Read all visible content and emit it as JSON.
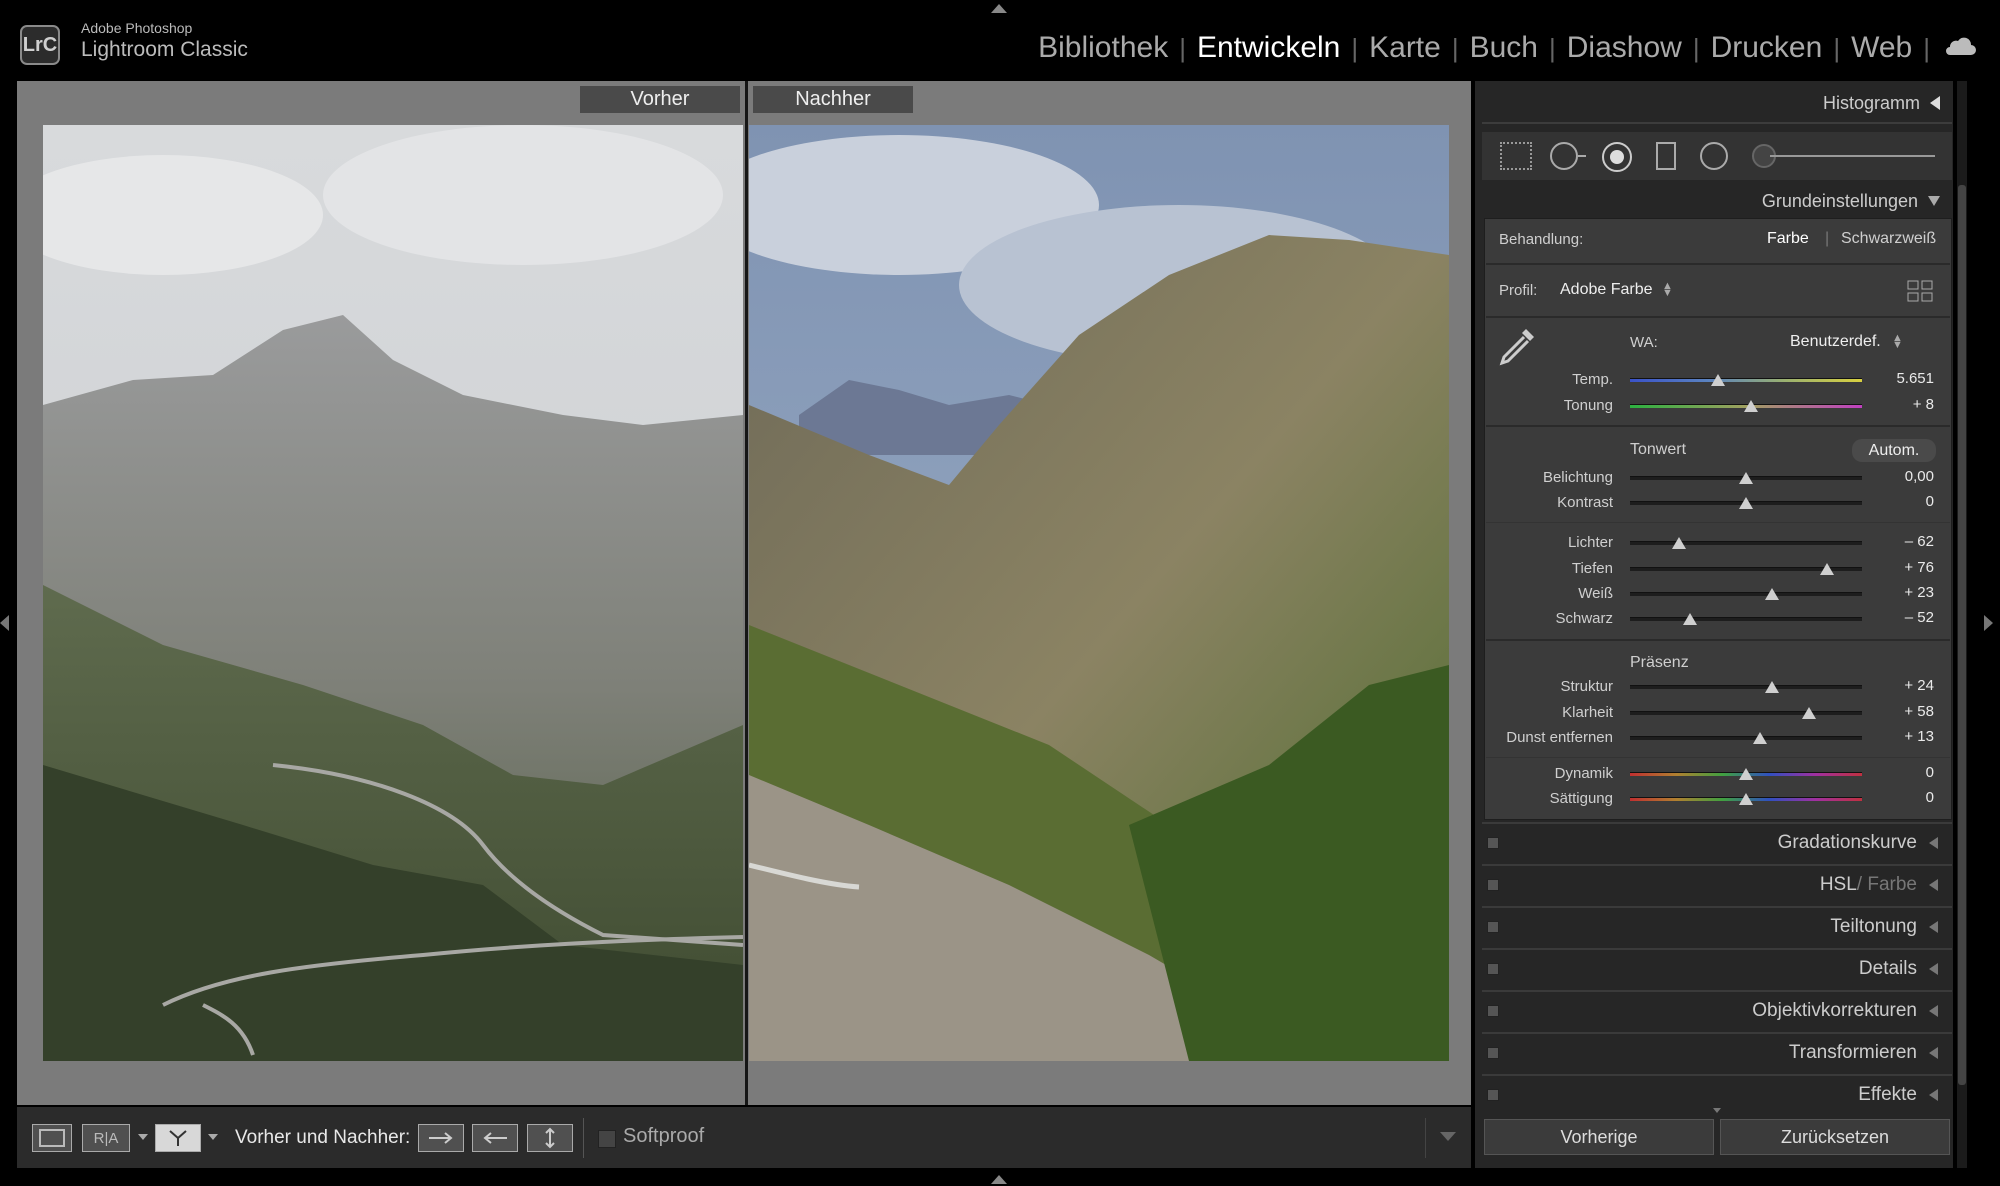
{
  "app": {
    "badge": "LrC",
    "line1": "Adobe Photoshop",
    "line2": "Lightroom Classic"
  },
  "modules": [
    "Bibliothek",
    "Entwickeln",
    "Karte",
    "Buch",
    "Diashow",
    "Drucken",
    "Web"
  ],
  "active_module": "Entwickeln",
  "viewer": {
    "before_label": "Vorher",
    "after_label": "Nachher"
  },
  "toolbar": {
    "ab_text": "R|A",
    "mode_label": "Vorher und Nachher:",
    "softproof_label": "Softproof"
  },
  "panel": {
    "histogram_title": "Histogramm",
    "basic_title": "Grundeinstellungen",
    "treatment": {
      "label": "Behandlung:",
      "color": "Farbe",
      "bw": "Schwarzweiß"
    },
    "profile": {
      "label": "Profil:",
      "value": "Adobe Farbe"
    },
    "wb": {
      "label": "WA:",
      "value": "Benutzerdef."
    },
    "tone_title": "Tonwert",
    "auto_label": "Autom.",
    "presence_title": "Präsenz",
    "sliders": [
      {
        "name": "temp",
        "label": "Temp.",
        "value": "5.651",
        "level": 0.38,
        "group": "wb"
      },
      {
        "name": "tonung",
        "label": "Tonung",
        "value": "+ 8",
        "level": 0.52,
        "group": "wb"
      },
      {
        "name": "belichtung",
        "label": "Belichtung",
        "value": "0,00",
        "level": 0.5,
        "group": "tone1"
      },
      {
        "name": "kontrast",
        "label": "Kontrast",
        "value": "0",
        "level": 0.5,
        "group": "tone1"
      },
      {
        "name": "lichter",
        "label": "Lichter",
        "value": "– 62",
        "level": 0.21,
        "group": "tone2"
      },
      {
        "name": "tiefen",
        "label": "Tiefen",
        "value": "+ 76",
        "level": 0.85,
        "group": "tone2"
      },
      {
        "name": "weiss",
        "label": "Weiß",
        "value": "+ 23",
        "level": 0.61,
        "group": "tone2"
      },
      {
        "name": "schwarz",
        "label": "Schwarz",
        "value": "– 52",
        "level": 0.26,
        "group": "tone2"
      },
      {
        "name": "struktur",
        "label": "Struktur",
        "value": "+ 24",
        "level": 0.61,
        "group": "presence"
      },
      {
        "name": "klarheit",
        "label": "Klarheit",
        "value": "+ 58",
        "level": 0.77,
        "group": "presence"
      },
      {
        "name": "dunst",
        "label": "Dunst entfernen",
        "value": "+ 13",
        "level": 0.56,
        "group": "presence"
      },
      {
        "name": "dynamik",
        "label": "Dynamik",
        "value": "0",
        "level": 0.5,
        "group": "color"
      },
      {
        "name": "saettigung",
        "label": "Sättigung",
        "value": "0",
        "level": 0.5,
        "group": "color"
      }
    ],
    "collapsed_sections": [
      "Gradationskurve",
      "HSL",
      "Teiltonung",
      "Details",
      "Objektivkorrekturen",
      "Transformieren",
      "Effekte"
    ],
    "hsl_suffix": "/ Farbe",
    "prev_button": "Vorherige",
    "reset_button": "Zurücksetzen"
  }
}
